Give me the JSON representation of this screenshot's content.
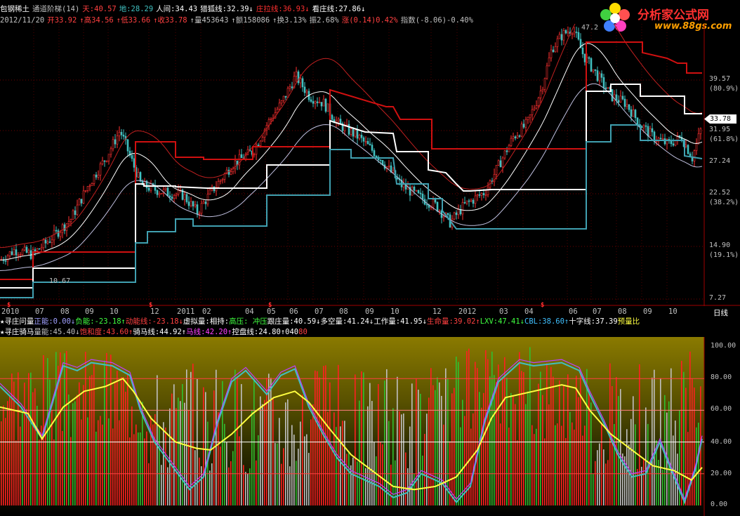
{
  "header": {
    "line1": [
      {
        "t": "包钢稀土",
        "c": "#ffffff"
      },
      {
        "t": "通道阶梯(14)",
        "c": "#c0c0c0"
      },
      {
        "t": "天:40.57",
        "c": "#ff4040"
      },
      {
        "t": "地:28.29",
        "c": "#40c0c0"
      },
      {
        "t": "人间:34.43",
        "c": "#ffffff"
      },
      {
        "t": "猎狐线:32.39↓",
        "c": "#ffffff"
      },
      {
        "t": "庄拉线:36.93↓",
        "c": "#ff3030"
      },
      {
        "t": "看庄线:27.86↓",
        "c": "#ffffff"
      }
    ],
    "line2": [
      {
        "t": "2012/11/20",
        "c": "#c0c0c0"
      },
      {
        "t": "开33.92",
        "c": "#ff4040"
      },
      {
        "t": "↑高34.56",
        "c": "#ff4040"
      },
      {
        "t": "↑低33.66",
        "c": "#ff4040"
      },
      {
        "t": "↑收33.78",
        "c": "#ff4040"
      },
      {
        "t": "↑量453643",
        "c": "#c0c0c0"
      },
      {
        "t": "↑额158086",
        "c": "#c0c0c0"
      },
      {
        "t": "↑换3.13%",
        "c": "#c0c0c0"
      },
      {
        "t": "振2.68%",
        "c": "#c0c0c0"
      },
      {
        "t": "涨(0.14)0.42%",
        "c": "#ff4040"
      },
      {
        "t": "指数(-8.06)-0.40%",
        "c": "#c0c0c0"
      }
    ]
  },
  "logo": {
    "title": "分析家公式网",
    "url": "www.88gs.com"
  },
  "price_axis": [
    {
      "label": "39.57",
      "y": 114
    },
    {
      "label": "(80.9%)",
      "y": 128
    },
    {
      "label": "31.95",
      "y": 186
    },
    {
      "label": "(61.8%)",
      "y": 200
    },
    {
      "label": "27.24",
      "y": 231
    },
    {
      "label": "22.52",
      "y": 276
    },
    {
      "label": "(38.2%)",
      "y": 290
    },
    {
      "label": "14.90",
      "y": 351
    },
    {
      "label": "(19.1%)",
      "y": 365
    },
    {
      "label": "7.27",
      "y": 426
    }
  ],
  "current_price": "33.78",
  "annotations": {
    "high": "47.2",
    "low": "10.67"
  },
  "x_axis": [
    {
      "label": "2010",
      "x": 0
    },
    {
      "label": "07",
      "x": 48
    },
    {
      "label": "08",
      "x": 84
    },
    {
      "label": "09",
      "x": 119
    },
    {
      "label": "10",
      "x": 154
    },
    {
      "label": "12",
      "x": 212
    },
    {
      "label": "2011",
      "x": 250
    },
    {
      "label": "02",
      "x": 286
    },
    {
      "label": "04",
      "x": 347
    },
    {
      "label": "05",
      "x": 378
    },
    {
      "label": "06",
      "x": 410
    },
    {
      "label": "07",
      "x": 446
    },
    {
      "label": "08",
      "x": 481
    },
    {
      "label": "09",
      "x": 518
    },
    {
      "label": "10",
      "x": 554
    },
    {
      "label": "12",
      "x": 614
    },
    {
      "label": "2012",
      "x": 651
    },
    {
      "label": "03",
      "x": 709
    },
    {
      "label": "04",
      "x": 745
    },
    {
      "label": "06",
      "x": 808
    },
    {
      "label": "07",
      "x": 842
    },
    {
      "label": "08",
      "x": 878
    },
    {
      "label": "09",
      "x": 914
    },
    {
      "label": "10",
      "x": 950
    }
  ],
  "period": "日线",
  "indicator1": {
    "items": [
      {
        "t": "★寻庄问量",
        "c": "#ffffff"
      },
      {
        "t": "正能:0.00↓",
        "c": "#a0a0ff"
      },
      {
        "t": "负能:-23.18↑",
        "c": "#40ff40"
      },
      {
        "t": "动能线:-23.18↓",
        "c": "#ff4040"
      },
      {
        "t": "虚拟量:相持:",
        "c": "#ffffff"
      },
      {
        "t": "高压: 冲压",
        "c": "#40ff40"
      },
      {
        "t": "跟庄量:40.59↓",
        "c": "#ffffff"
      },
      {
        "t": "多空量:41.24↓",
        "c": "#ffffff"
      },
      {
        "t": "工作量:41.95↓",
        "c": "#ffffff"
      },
      {
        "t": "生命量:39.02↑",
        "c": "#ff4040"
      },
      {
        "t": "LXV:47.41↓",
        "c": "#40ff40"
      },
      {
        "t": "CBL:38.60↑",
        "c": "#40c0ff"
      },
      {
        "t": "十字线:37.39",
        "c": "#ffffff"
      },
      {
        "t": "预量比",
        "c": "#ffff40"
      }
    ]
  },
  "indicator2": {
    "items": [
      {
        "t": "★寻庄骑马",
        "c": "#ffffff"
      },
      {
        "t": "量能:45.40↓",
        "c": "#c0c0c0"
      },
      {
        "t": "饱和度:43.60↑",
        "c": "#ff4040"
      },
      {
        "t": "骑马线:44.92↑",
        "c": "#ffffff"
      },
      {
        "t": "马线:42.20↑",
        "c": "#ff40ff"
      },
      {
        "t": "控盘线:24.80↑",
        "c": "#ffffff"
      },
      {
        "t": "0",
        "c": "#ffffff"
      },
      {
        "t": "40",
        "c": "#ffffff"
      },
      {
        "t": "80",
        "c": "#ff4040"
      }
    ]
  },
  "ind_axis": [
    {
      "label": "100.00",
      "y": 494
    },
    {
      "label": "80.00",
      "y": 539
    },
    {
      "label": "60.00",
      "y": 584
    },
    {
      "label": "40.00",
      "y": 631
    },
    {
      "label": "20.00",
      "y": 676
    },
    {
      "label": "0.00",
      "y": 720
    }
  ],
  "colors": {
    "bg": "#000000",
    "up": "#ff3030",
    "down": "#40c0c0",
    "red_step": "#d01010",
    "white_step": "#ffffff",
    "teal_step": "#40a0b0"
  },
  "chart_data": {
    "type": "line",
    "title": "包钢稀土",
    "xlabel": "",
    "ylabel": "",
    "ylim": [
      7.27,
      47.2
    ],
    "series": [
      {
        "name": "庄拉线",
        "values": [
          12,
          14,
          13,
          14,
          20,
          24,
          30,
          40,
          38,
          36,
          41,
          42,
          47,
          38,
          37,
          36
        ]
      },
      {
        "name": "猎狐线",
        "values": [
          10,
          12,
          13,
          15,
          19,
          23,
          26,
          31,
          27,
          25,
          22,
          24,
          30,
          35,
          34,
          32
        ]
      },
      {
        "name": "看庄线",
        "values": [
          9,
          10,
          11,
          13,
          17,
          21,
          23,
          28,
          26,
          22,
          18,
          20,
          26,
          30,
          29,
          28
        ]
      }
    ]
  }
}
